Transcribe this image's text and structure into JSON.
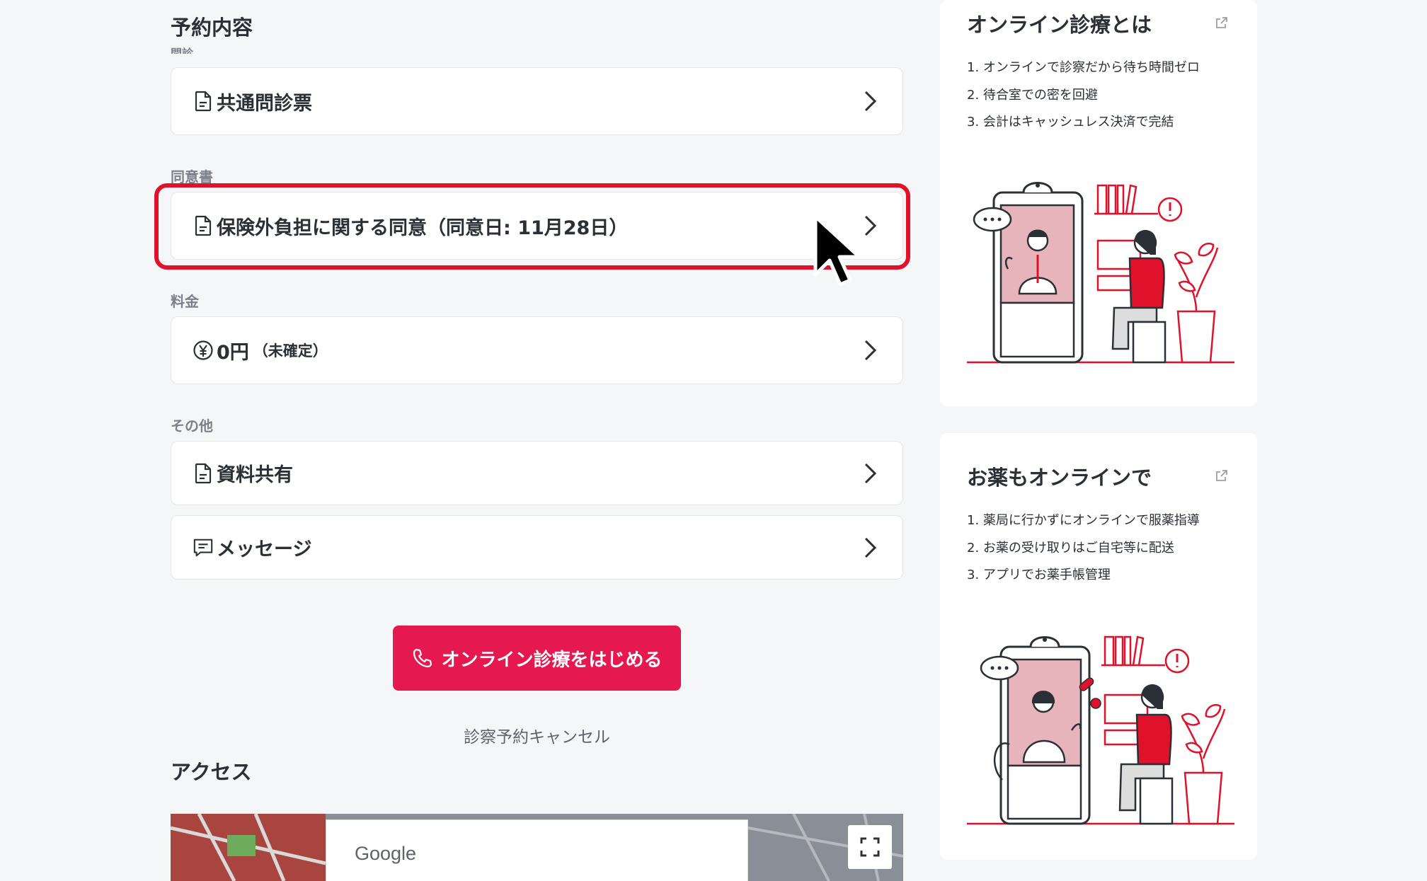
{
  "reservation": {
    "title": "予約内容",
    "monshin_label": "問診",
    "monshin_item": "共通問診票",
    "consent_label": "同意書",
    "consent_item": "保険外負担に関する同意（同意日: 11月28日）",
    "fee_label": "料金",
    "fee_amount": "0円",
    "fee_note": "（未確定）",
    "other_label": "その他",
    "documents_item": "資料共有",
    "message_item": "メッセージ"
  },
  "actions": {
    "start_button": "オンライン診療をはじめる",
    "cancel_link": "診察予約キャンセル"
  },
  "access": {
    "title": "アクセス",
    "map_brand": "Google"
  },
  "side_cards": [
    {
      "title": "オンライン診療とは",
      "points": [
        "1. オンラインで診察だから待ち時間ゼロ",
        "2. 待合室での密を回避",
        "3. 会計はキャッシュレス決済で完結"
      ]
    },
    {
      "title": "お薬もオンラインで",
      "points": [
        "1. 薬局に行かずにオンラインで服薬指導",
        "2. お薬の受け取りはご自宅等に配送",
        "3. アプリでお薬手帳管理"
      ]
    }
  ],
  "colors": {
    "accent": "#e5194f",
    "highlight": "#e0112b",
    "background": "#f5f6f8"
  },
  "icons": [
    "document-icon",
    "yen-icon",
    "message-icon",
    "chevron-right-icon",
    "phone-icon",
    "external-link-icon",
    "fullscreen-icon",
    "mouse-cursor"
  ]
}
